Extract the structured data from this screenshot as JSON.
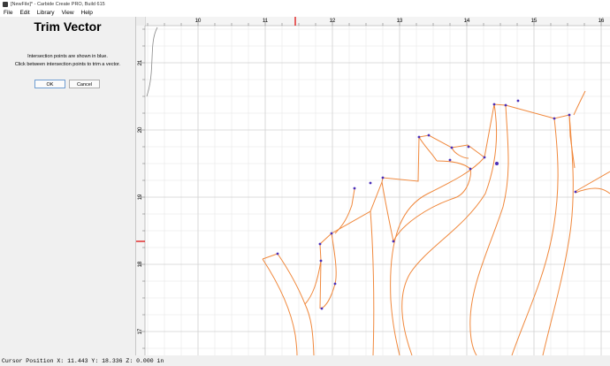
{
  "window": {
    "title": "[NewFile]* - Carbide Create PRO, Build 615"
  },
  "menu": [
    "File",
    "Edit",
    "Library",
    "View",
    "Help"
  ],
  "panel": {
    "title": "Trim Vector",
    "instruction1": "Intersection points are shown in blue.",
    "instruction2": "Click between intersection points to trim a vector.",
    "ok_label": "OK",
    "cancel_label": "Cancel"
  },
  "ruler": {
    "x_labels": [
      "10",
      "11",
      "12",
      "13",
      "14",
      "15",
      "16"
    ],
    "y_labels": [
      "21",
      "20",
      "19",
      "18",
      "17"
    ]
  },
  "status": {
    "cursor_position": "Cursor Position X: 11.443 Y: 18.336 Z: 0.000 in"
  },
  "colors": {
    "vector": "#f0883c",
    "intersection": "#4a2fb8",
    "grid": "#e6e6e6",
    "ruler_marker": "#e02020"
  }
}
